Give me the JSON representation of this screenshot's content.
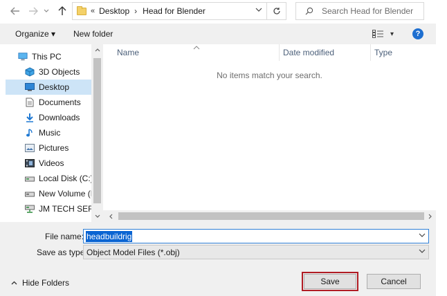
{
  "address_bar": {
    "overflow_chevron": "«",
    "breadcrumbs": [
      "Desktop",
      "Head for Blender"
    ],
    "separator": "›",
    "search_placeholder": "Search Head for Blender"
  },
  "toolbar": {
    "organize_label": "Organize ▾",
    "new_folder_label": "New folder",
    "view_dropdown": "▾",
    "help_label": "?"
  },
  "nav_pane": {
    "items": [
      {
        "label": "This PC",
        "icon": "computer-icon",
        "level": 0,
        "selected": false
      },
      {
        "label": "3D Objects",
        "icon": "3d-objects-icon",
        "level": 1,
        "selected": false
      },
      {
        "label": "Desktop",
        "icon": "desktop-icon",
        "level": 1,
        "selected": true
      },
      {
        "label": "Documents",
        "icon": "documents-icon",
        "level": 1,
        "selected": false
      },
      {
        "label": "Downloads",
        "icon": "downloads-icon",
        "level": 1,
        "selected": false
      },
      {
        "label": "Music",
        "icon": "music-icon",
        "level": 1,
        "selected": false
      },
      {
        "label": "Pictures",
        "icon": "pictures-icon",
        "level": 1,
        "selected": false
      },
      {
        "label": "Videos",
        "icon": "videos-icon",
        "level": 1,
        "selected": false
      },
      {
        "label": "Local Disk (C:)",
        "icon": "drive-icon",
        "level": 1,
        "selected": false
      },
      {
        "label": "New Volume (D:",
        "icon": "drive-icon",
        "level": 1,
        "selected": false
      },
      {
        "label": "JM TECH SERVIC",
        "icon": "network-drive-icon",
        "level": 1,
        "selected": false
      }
    ]
  },
  "file_list": {
    "columns": [
      "Name",
      "Date modified",
      "Type"
    ],
    "empty_message": "No items match your search."
  },
  "form": {
    "file_name_label": "File name:",
    "file_name_value": "headbuildrig",
    "save_as_type_label": "Save as type:",
    "save_as_type_value": "Object Model Files (*.obj)"
  },
  "footer": {
    "hide_folders_label": "Hide Folders",
    "save_label": "Save",
    "cancel_label": "Cancel"
  },
  "colors": {
    "selection": "#cde4f7",
    "accent": "#0a64d2",
    "save_highlight": "#b01c24"
  }
}
